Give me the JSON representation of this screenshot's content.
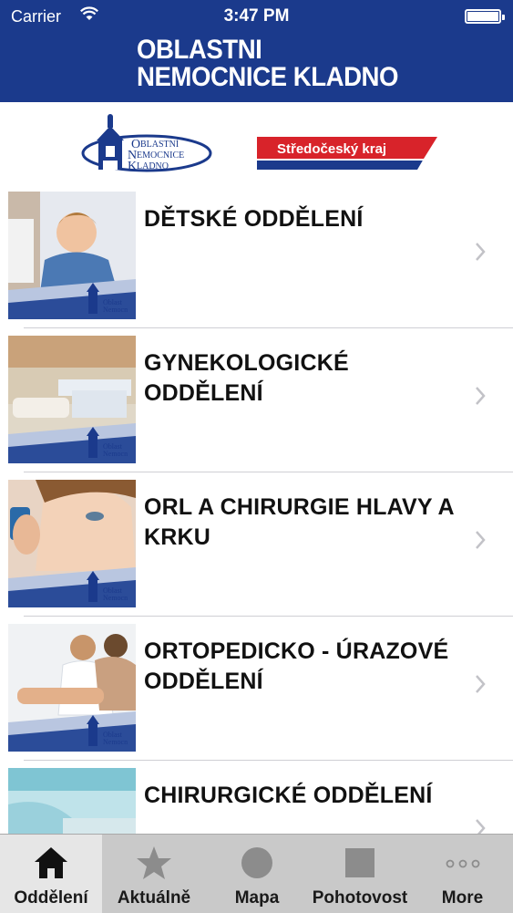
{
  "status_bar": {
    "carrier": "Carrier",
    "time": "3:47 PM"
  },
  "header": {
    "title_line1": "OBLASTNI",
    "title_line2": "NEMOCNICE KLADNO"
  },
  "logos": {
    "hospital_text_line1": "BLASTNÍ",
    "hospital_text_line2": "EMOCNICE",
    "hospital_text_line3": "LADNO",
    "region_text": "Středočeský kraj"
  },
  "departments": [
    {
      "title": "DĚTSKÉ ODDĚLENÍ"
    },
    {
      "title": "GYNEKOLOGICKÉ ODDĚLENÍ"
    },
    {
      "title": "ORL A CHIRURGIE HLAVY A KRKU"
    },
    {
      "title": "ORTOPEDICKO - ÚRAZOVÉ ODDĚLENÍ"
    },
    {
      "title": "CHIRURGICKÉ ODDĚLENÍ"
    }
  ],
  "tabbar": {
    "tabs": [
      {
        "label": "Oddělení",
        "icon": "home-icon",
        "active": true
      },
      {
        "label": "Aktuálně",
        "icon": "star-icon"
      },
      {
        "label": "Mapa",
        "icon": "circle-icon"
      },
      {
        "label": "Pohotovost",
        "icon": "square-icon"
      },
      {
        "label": "More",
        "icon": "more-dots-icon"
      }
    ]
  },
  "colors": {
    "header_blue": "#1b3a8c",
    "region_red": "#d8232a",
    "tabbar_bg": "#c9c9c9"
  }
}
